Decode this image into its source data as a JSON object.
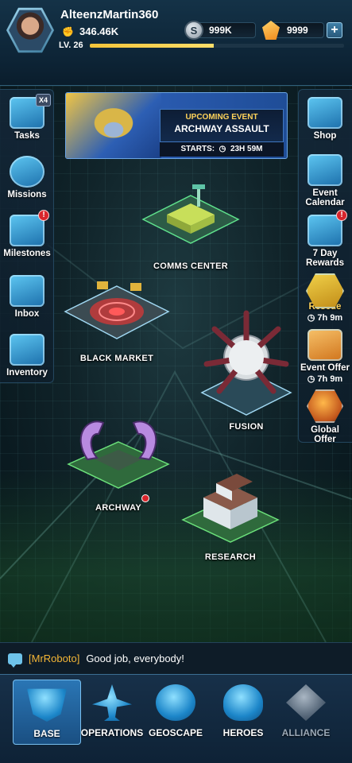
{
  "player": {
    "name": "AlteenzMartin360",
    "power": "346.46K",
    "level": "LV. 26",
    "xp_fraction": 0.49
  },
  "currencies": {
    "silver": {
      "icon": "silver-coin-icon",
      "symbol": "S",
      "amount": "999K"
    },
    "gems": {
      "icon": "gem-icon",
      "amount": "9999"
    },
    "add_label": "+"
  },
  "left_menu": [
    {
      "label": "Tasks",
      "icon": "tasks-clipboard-icon",
      "badge": "X4"
    },
    {
      "label": "Missions",
      "icon": "radar-icon"
    },
    {
      "label": "Milestones",
      "icon": "star-shield-icon",
      "badge": "!"
    },
    {
      "label": "Inbox",
      "icon": "envelope-icon"
    },
    {
      "label": "Inventory",
      "icon": "crate-icon"
    }
  ],
  "right_menu": [
    {
      "label": "Shop",
      "icon": "treasure-chest-icon"
    },
    {
      "label": "Event Calendar",
      "icon": "calendar-icon"
    },
    {
      "label": "7 Day Rewards",
      "icon": "calendar-reward-icon",
      "badge": "!"
    },
    {
      "label": "Rescue",
      "icon": "rescue-portrait-icon",
      "timer": "7h 9m"
    },
    {
      "label": "Event Offer",
      "icon": "event-offer-icon",
      "timer": "7h 9m"
    },
    {
      "label": "Global Offer",
      "icon": "globe-offer-icon"
    }
  ],
  "event": {
    "subtitle": "UPCOMING EVENT",
    "name": "ARCHWAY ASSAULT",
    "starts_label": "STARTS:",
    "starts_time": "23H 59M"
  },
  "buildings": [
    {
      "label": "COMMS CENTER"
    },
    {
      "label": "BLACK MARKET"
    },
    {
      "label": "FUSION"
    },
    {
      "label": "ARCHWAY"
    },
    {
      "label": "RESEARCH"
    }
  ],
  "chat": {
    "sender": "[MrRoboto]",
    "message": "Good job, everybody!"
  },
  "nav": [
    {
      "label": "BASE",
      "icon": "base-shield-icon",
      "active": true
    },
    {
      "label": "OPERATIONS",
      "icon": "jet-icon"
    },
    {
      "label": "GEOSCAPE",
      "icon": "globe-icon"
    },
    {
      "label": "HEROES",
      "icon": "soldier-helmet-icon"
    },
    {
      "label": "ALLIANCE",
      "icon": "alliance-lock-icon",
      "disabled": true
    }
  ],
  "colors": {
    "accent_blue": "#2a76b5",
    "xp_yellow": "#f3c43a",
    "alert_red": "#d9252c",
    "chat_name": "#f4b636"
  }
}
